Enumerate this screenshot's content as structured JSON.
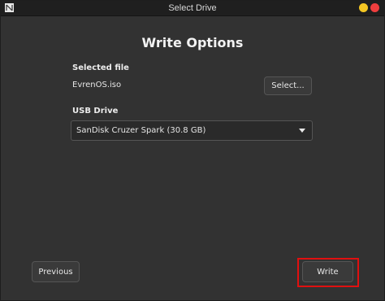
{
  "window": {
    "title": "Select Drive",
    "app_icon": "app-logo-icon",
    "controls": {
      "minimize_color": "#f3c623",
      "close_color": "#ef3e3e"
    }
  },
  "main": {
    "heading": "Write Options",
    "selected_file": {
      "label": "Selected file",
      "value": "EvrenOS.iso",
      "button_label": "Select..."
    },
    "usb_drive": {
      "label": "USB Drive",
      "selected": "SanDisk Cruzer Spark (30.8 GB)",
      "icon": "chevron-down-icon"
    }
  },
  "footer": {
    "previous_label": "Previous",
    "write_label": "Write",
    "highlight_color": "#e01010"
  }
}
